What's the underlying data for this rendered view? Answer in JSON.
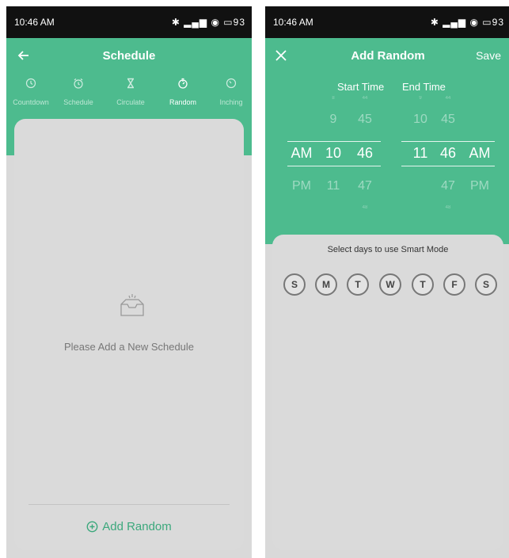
{
  "left": {
    "status": {
      "time": "10:46 AM",
      "battery": "93"
    },
    "appbar": {
      "title": "Schedule"
    },
    "tabs": [
      {
        "label": "Countdown",
        "icon": "clock-icon"
      },
      {
        "label": "Schedule",
        "icon": "alarm-clock-icon"
      },
      {
        "label": "Circulate",
        "icon": "hourglass-icon"
      },
      {
        "label": "Random",
        "icon": "stopwatch-icon",
        "active": true
      },
      {
        "label": "Inching",
        "icon": "timer-icon"
      }
    ],
    "empty_message": "Please Add a New Schedule",
    "add_label": "Add Random"
  },
  "right": {
    "status": {
      "time": "10:46 AM",
      "battery": "93"
    },
    "appbar": {
      "title": "Add Random",
      "save_label": "Save"
    },
    "start_time": {
      "label": "Start Time",
      "ampm": [
        "AM",
        "PM"
      ],
      "hours": [
        "9",
        "10",
        "11"
      ],
      "minutes": [
        "45",
        "46",
        "47"
      ]
    },
    "end_time": {
      "label": "End Time",
      "hours": [
        "10",
        "11"
      ],
      "minutes": [
        "45",
        "46",
        "47"
      ],
      "ampm": [
        "AM",
        "PM"
      ]
    },
    "days_title": "Select days to use Smart Mode",
    "days": [
      "S",
      "M",
      "T",
      "W",
      "T",
      "F",
      "S"
    ]
  },
  "colors": {
    "accent": "#4dbb8e",
    "accent_dark": "#3ca87c"
  }
}
